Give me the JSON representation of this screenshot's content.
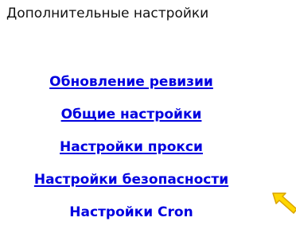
{
  "header": {
    "title": "Дополнительные настройки"
  },
  "menu": {
    "items": [
      {
        "label": "Обновление ревизии"
      },
      {
        "label": "Общие настройки"
      },
      {
        "label": "Настройки прокси"
      },
      {
        "label": "Настройки безопасности"
      },
      {
        "label": "Настройки Cron"
      }
    ]
  },
  "colors": {
    "link": "#0000e0",
    "pointer_fill": "#ffd700",
    "pointer_outline": "#d9a300"
  },
  "icons": {
    "pointer": "pointer-arrow-icon"
  }
}
